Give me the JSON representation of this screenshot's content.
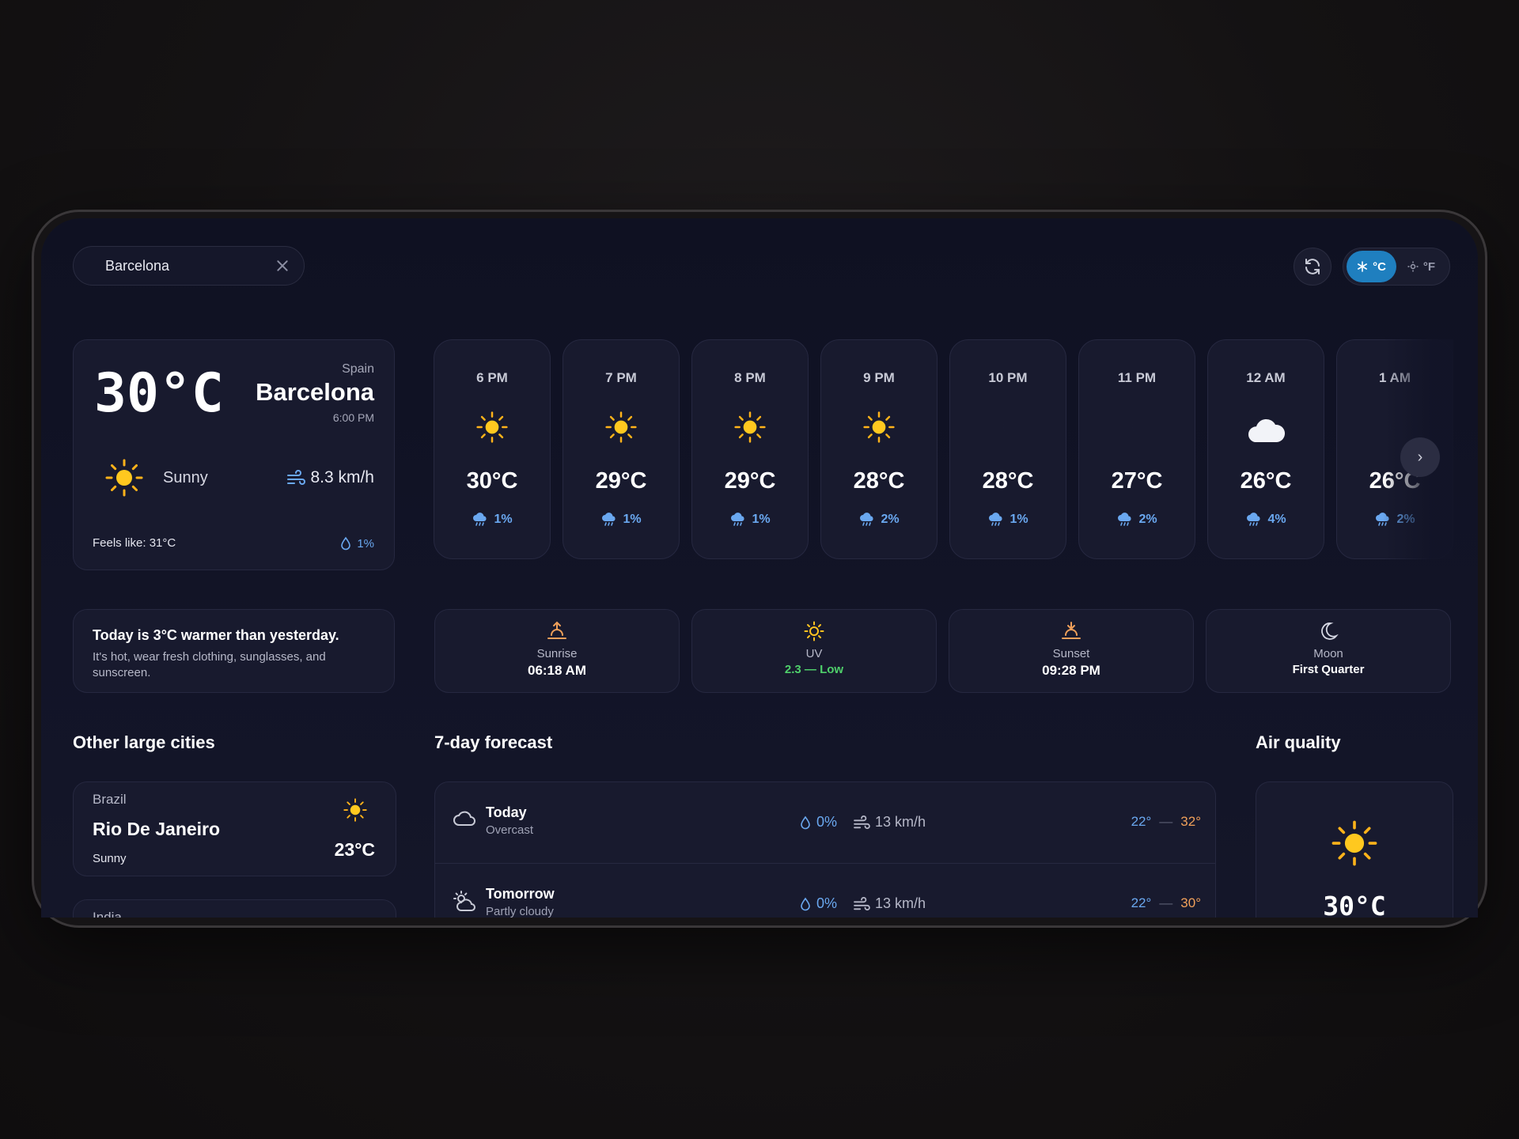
{
  "search": {
    "value": "Barcelona"
  },
  "units": {
    "celsius": "°C",
    "fahrenheit": "°F"
  },
  "current": {
    "temperature": "30°C",
    "country": "Spain",
    "city": "Barcelona",
    "time": "6:00 PM",
    "condition": "Sunny",
    "wind": "8.3 km/h",
    "feels_like": "Feels like: 31°C",
    "precip": "1%"
  },
  "hourly": [
    {
      "time": "6 PM",
      "icon": "sun-icon",
      "temp": "30°C",
      "precip": "1%"
    },
    {
      "time": "7 PM",
      "icon": "sun-icon",
      "temp": "29°C",
      "precip": "1%"
    },
    {
      "time": "8 PM",
      "icon": "sun-icon",
      "temp": "29°C",
      "precip": "1%"
    },
    {
      "time": "9 PM",
      "icon": "sun-icon",
      "temp": "28°C",
      "precip": "2%"
    },
    {
      "time": "10 PM",
      "icon": "moon-icon",
      "temp": "28°C",
      "precip": "1%"
    },
    {
      "time": "11 PM",
      "icon": "moon-icon",
      "temp": "27°C",
      "precip": "2%"
    },
    {
      "time": "12 AM",
      "icon": "moon-cloud-icon",
      "temp": "26°C",
      "precip": "4%"
    },
    {
      "time": "1 AM",
      "icon": "moon-icon",
      "temp": "26°C",
      "precip": "2%"
    }
  ],
  "tip": {
    "title": "Today is 3°C warmer than yesterday.",
    "body": "It's hot, wear fresh clothing, sunglasses, and sunscreen."
  },
  "stats": {
    "sunrise": {
      "label": "Sunrise",
      "value": "06:18 AM"
    },
    "uv": {
      "label": "UV",
      "value": "2.3 — Low"
    },
    "sunset": {
      "label": "Sunset",
      "value": "09:28 PM"
    },
    "moon": {
      "label": "Moon",
      "value": "First Quarter"
    }
  },
  "sections": {
    "cities": "Other large cities",
    "forecast": "7-day forecast",
    "air": "Air quality"
  },
  "cities": [
    {
      "country": "Brazil",
      "name": "Rio De Janeiro",
      "condition": "Sunny",
      "temp": "23°C"
    },
    {
      "country": "India"
    }
  ],
  "forecast": [
    {
      "day": "Today",
      "condition": "Overcast",
      "precip": "0%",
      "wind": "13 km/h",
      "min": "22°",
      "max": "32°",
      "icon": "cloud-icon"
    },
    {
      "day": "Tomorrow",
      "condition": "Partly cloudy",
      "precip": "0%",
      "wind": "13 km/h",
      "min": "22°",
      "max": "30°",
      "icon": "partly-cloudy-icon"
    }
  ],
  "range_sep": "—",
  "air": {
    "temp": "30°C"
  },
  "colors": {
    "accent": "#1f7fbf",
    "precip": "#6aa8f0",
    "sun": "#ffc31f",
    "uv_low": "#4fd06b",
    "max_temp": "#f0a05a"
  }
}
